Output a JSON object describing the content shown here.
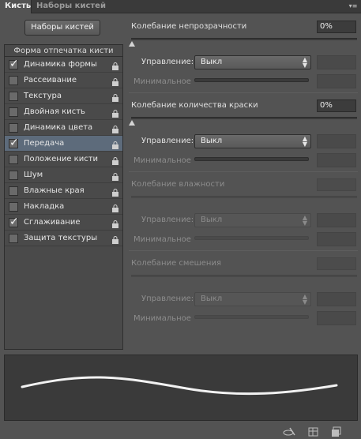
{
  "tabs": [
    {
      "label": "Кисть",
      "active": true
    },
    {
      "label": "Наборы кистей",
      "active": false
    }
  ],
  "panel_menu_icon": "panel-menu-icon",
  "presets_button": "Наборы кистей",
  "brush_list": {
    "header": "Форма отпечатка кисти",
    "items": [
      {
        "label": "Динамика формы",
        "checked": true,
        "selected": false
      },
      {
        "label": "Рассеивание",
        "checked": false,
        "selected": false
      },
      {
        "label": "Текстура",
        "checked": false,
        "selected": false
      },
      {
        "label": "Двойная кисть",
        "checked": false,
        "selected": false
      },
      {
        "label": "Динамика цвета",
        "checked": false,
        "selected": false
      },
      {
        "label": "Передача",
        "checked": true,
        "selected": true
      },
      {
        "label": "Положение кисти",
        "checked": false,
        "selected": false
      },
      {
        "label": "Шум",
        "checked": false,
        "selected": false
      },
      {
        "label": "Влажные края",
        "checked": false,
        "selected": false
      },
      {
        "label": "Накладка",
        "checked": false,
        "selected": false
      },
      {
        "label": "Сглаживание",
        "checked": true,
        "selected": false
      },
      {
        "label": "Защита текстуры",
        "checked": false,
        "selected": false
      }
    ]
  },
  "sections": [
    {
      "title": "Колебание непрозрачности",
      "value": "0%",
      "enabled": true,
      "control_label": "Управление:",
      "control_value": "Выкл",
      "min_label": "Минимальное"
    },
    {
      "title": "Колебание количества краски",
      "value": "0%",
      "enabled": true,
      "control_label": "Управление:",
      "control_value": "Выкл",
      "min_label": "Минимальное"
    },
    {
      "title": "Колебание влажности",
      "value": "",
      "enabled": false,
      "control_label": "Управление:",
      "control_value": "Выкл",
      "min_label": "Минимальное"
    },
    {
      "title": "Колебание смешения",
      "value": "",
      "enabled": false,
      "control_label": "Управление:",
      "control_value": "Выкл",
      "min_label": "Минимальное"
    }
  ],
  "bottom_icons": [
    "brush-visibility-icon",
    "grid-icon",
    "new-preset-icon"
  ],
  "colors": {
    "panel_bg": "#535353",
    "selected_row": "#5d6b7b",
    "preview_bg": "#3a3a3a"
  }
}
